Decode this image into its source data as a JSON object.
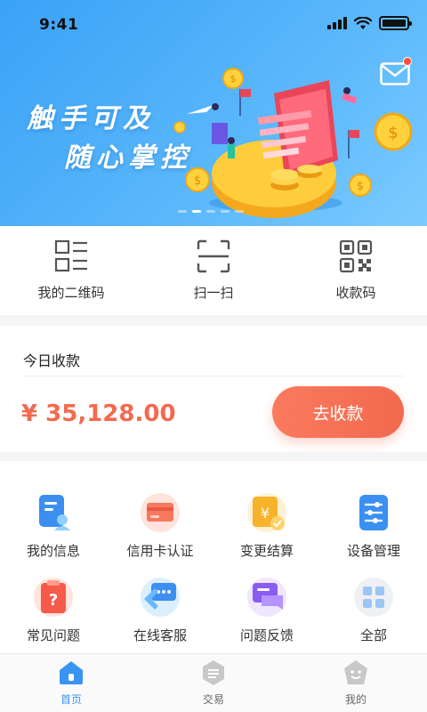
{
  "status_bar": {
    "time": "9:41"
  },
  "banner": {
    "slogan_line1": "触手可及",
    "slogan_line2": "随心掌控",
    "slide_count": 5,
    "active_slide": 2
  },
  "quick_actions": [
    {
      "label": "我的二维码",
      "icon": "qrcode-card-icon"
    },
    {
      "label": "扫一扫",
      "icon": "scan-icon"
    },
    {
      "label": "收款码",
      "icon": "payment-qrcode-icon"
    }
  ],
  "today": {
    "title": "今日收款",
    "amount": "¥ 35,128.00",
    "button_label": "去收款"
  },
  "grid": [
    {
      "label": "我的信息",
      "icon": "profile-card-icon"
    },
    {
      "label": "信用卡认证",
      "icon": "credit-card-icon"
    },
    {
      "label": "变更结算",
      "icon": "settlement-icon"
    },
    {
      "label": "设备管理",
      "icon": "device-settings-icon"
    },
    {
      "label": "常见问题",
      "icon": "faq-icon"
    },
    {
      "label": "在线客服",
      "icon": "online-service-icon"
    },
    {
      "label": "问题反馈",
      "icon": "feedback-icon"
    },
    {
      "label": "全部",
      "icon": "all-apps-icon"
    }
  ],
  "tabbar": [
    {
      "label": "首页",
      "icon": "home-icon",
      "active": true
    },
    {
      "label": "交易",
      "icon": "transaction-icon",
      "active": false
    },
    {
      "label": "我的",
      "icon": "profile-icon",
      "active": false
    }
  ],
  "colors": {
    "brand_blue": "#3aa2f7",
    "accent_orange": "#f36a4e",
    "tab_active": "#3a95f2"
  }
}
